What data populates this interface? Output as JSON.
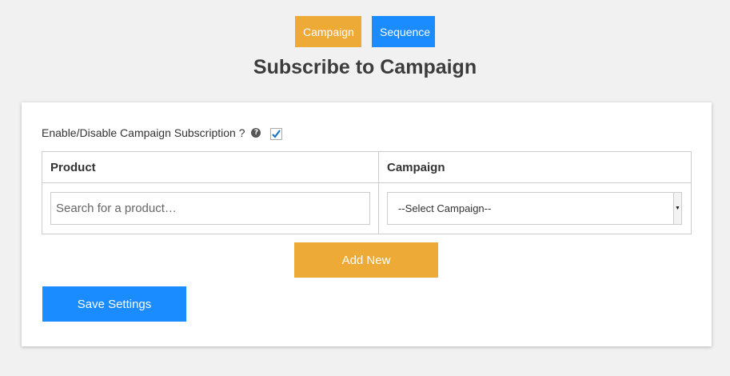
{
  "tabs": {
    "campaign_label": "Campaign",
    "sequence_label": "Sequence"
  },
  "page": {
    "title": "Subscribe to Campaign"
  },
  "settings": {
    "enable_label": "Enable/Disable Campaign Subscription ?",
    "enable_checked": true,
    "help_icon": "question-circle-icon"
  },
  "table": {
    "headers": [
      "Product",
      "Campaign"
    ],
    "product_placeholder": "Search for a product…",
    "campaign_selected": "--Select Campaign--"
  },
  "actions": {
    "add_new_label": "Add New",
    "save_label": "Save Settings"
  },
  "colors": {
    "accent_orange": "#eeaa37",
    "accent_blue": "#1b8cff",
    "check_blue": "#1e73be"
  }
}
